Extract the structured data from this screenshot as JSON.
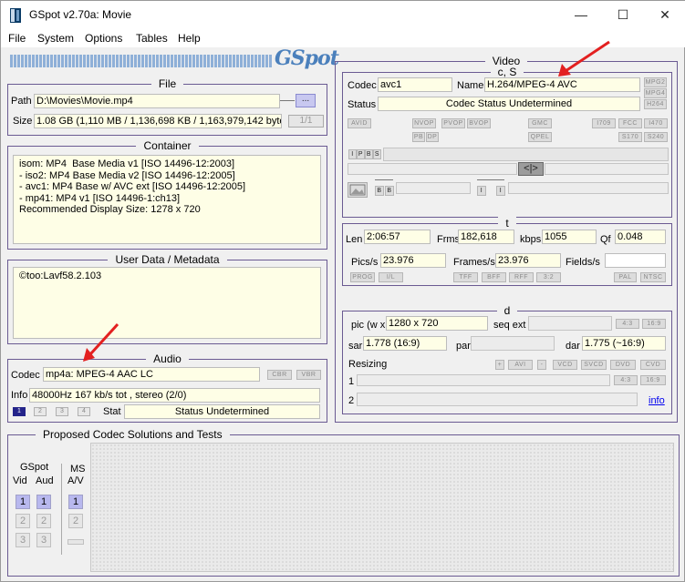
{
  "window": {
    "title": "GSpot v2.70a: Movie",
    "min_icon": "minimize-icon",
    "max_icon": "maximize-icon",
    "close_icon": "close-icon",
    "min_glyph": "—",
    "max_glyph": "☐",
    "close_glyph": "✕"
  },
  "menu": [
    "File",
    "System",
    "Options",
    "Tables",
    "Help"
  ],
  "logo": "GSpot",
  "file": {
    "title": "File",
    "path_label": "Path",
    "path": "D:\\Movies\\Movie.mp4",
    "browse": "...",
    "size_label": "Size",
    "size": "1.08 GB (1,110 MB / 1,136,698 KB / 1,163,979,142 byte",
    "page": "1/1"
  },
  "container": {
    "title": "Container",
    "lines": [
      "isom: MP4  Base Media v1 [ISO 14496-12:2003]",
      "- iso2: MP4 Base Media v2 [ISO 14496-12:2005]",
      "- avc1: MP4 Base w/ AVC ext [ISO 14496-12:2005]",
      "- mp41: MP4 v1 [ISO 14496-1:ch13]",
      "Recommended Display Size: 1278 x 720"
    ]
  },
  "userdata": {
    "title": "User Data / Metadata",
    "text": "©too:Lavf58.2.103"
  },
  "audio": {
    "title": "Audio",
    "codec_label": "Codec",
    "codec": "mp4a: MPEG-4 AAC LC",
    "cbr": "CBR",
    "vbr": "VBR",
    "info_label": "Info",
    "info": "48000Hz  167 kb/s tot , stereo (2/0)",
    "tracks": [
      "1",
      "2",
      "3",
      "4"
    ],
    "stat_label": "Stat",
    "stat": "Status Undetermined"
  },
  "video": {
    "title": "Video",
    "cs_title": "c, S",
    "codec_label": "Codec",
    "codec": "avc1",
    "name_label": "Name",
    "name": "H.264/MPEG-4 AVC",
    "status_label": "Status",
    "status": "Codec Status Undetermined",
    "side_btns": [
      "MPG2",
      "MPG4",
      "H264"
    ],
    "row_btns": [
      "AVID",
      "NVOP",
      "PVOP",
      "BVOP",
      "GMC",
      "I709",
      "FCC",
      "I470",
      "PB",
      "DP",
      "QPEL",
      "S170",
      "S240"
    ],
    "frame_btns": [
      "I",
      "P",
      "B",
      "S"
    ],
    "bf_btns": [
      "B",
      "B"
    ],
    "ii_btns": [
      "I",
      "I"
    ],
    "t_title": "t",
    "len_label": "Len",
    "len": "2:06:57",
    "frms_label": "Frms",
    "frms": "182,618",
    "kbps_label": "kbps",
    "kbps": "1055",
    "qf_label": "Qf",
    "qf": "0.048",
    "pics_label": "Pics/s",
    "pics": "23.976",
    "frames_label": "Frames/s",
    "frames": "23.976",
    "fields_label": "Fields/s",
    "t_btns": [
      "PROG",
      "I/L",
      "TFF",
      "BFF",
      "RFF",
      "3:2",
      "PAL",
      "NTSC"
    ],
    "d_title": "d",
    "pic_label": "pic (w x",
    "pic": "1280 x 720",
    "seqext_label": "seq ext",
    "ratio_btns": [
      "4:3",
      "16:9"
    ],
    "sar_label": "sar",
    "sar": "1.778 (16:9)",
    "par_label": "par",
    "dar_label": "dar",
    "dar": "1.775 (~16:9)",
    "resizing_label": "Resizing",
    "resize_btns": [
      "+",
      "AVI",
      "-",
      "VCD",
      "SVCD",
      "DVD",
      "CVD"
    ],
    "resize_ratio_btns": [
      "4:3",
      "16:9"
    ],
    "row1": "1",
    "row2": "2",
    "info_link": "info"
  },
  "proposed": {
    "title": "Proposed Codec Solutions and Tests",
    "gspot": "GSpot",
    "vid": "Vid",
    "aud": "Aud",
    "ms": "MS",
    "av": "A/V",
    "nums": [
      "1",
      "2",
      "3"
    ]
  }
}
